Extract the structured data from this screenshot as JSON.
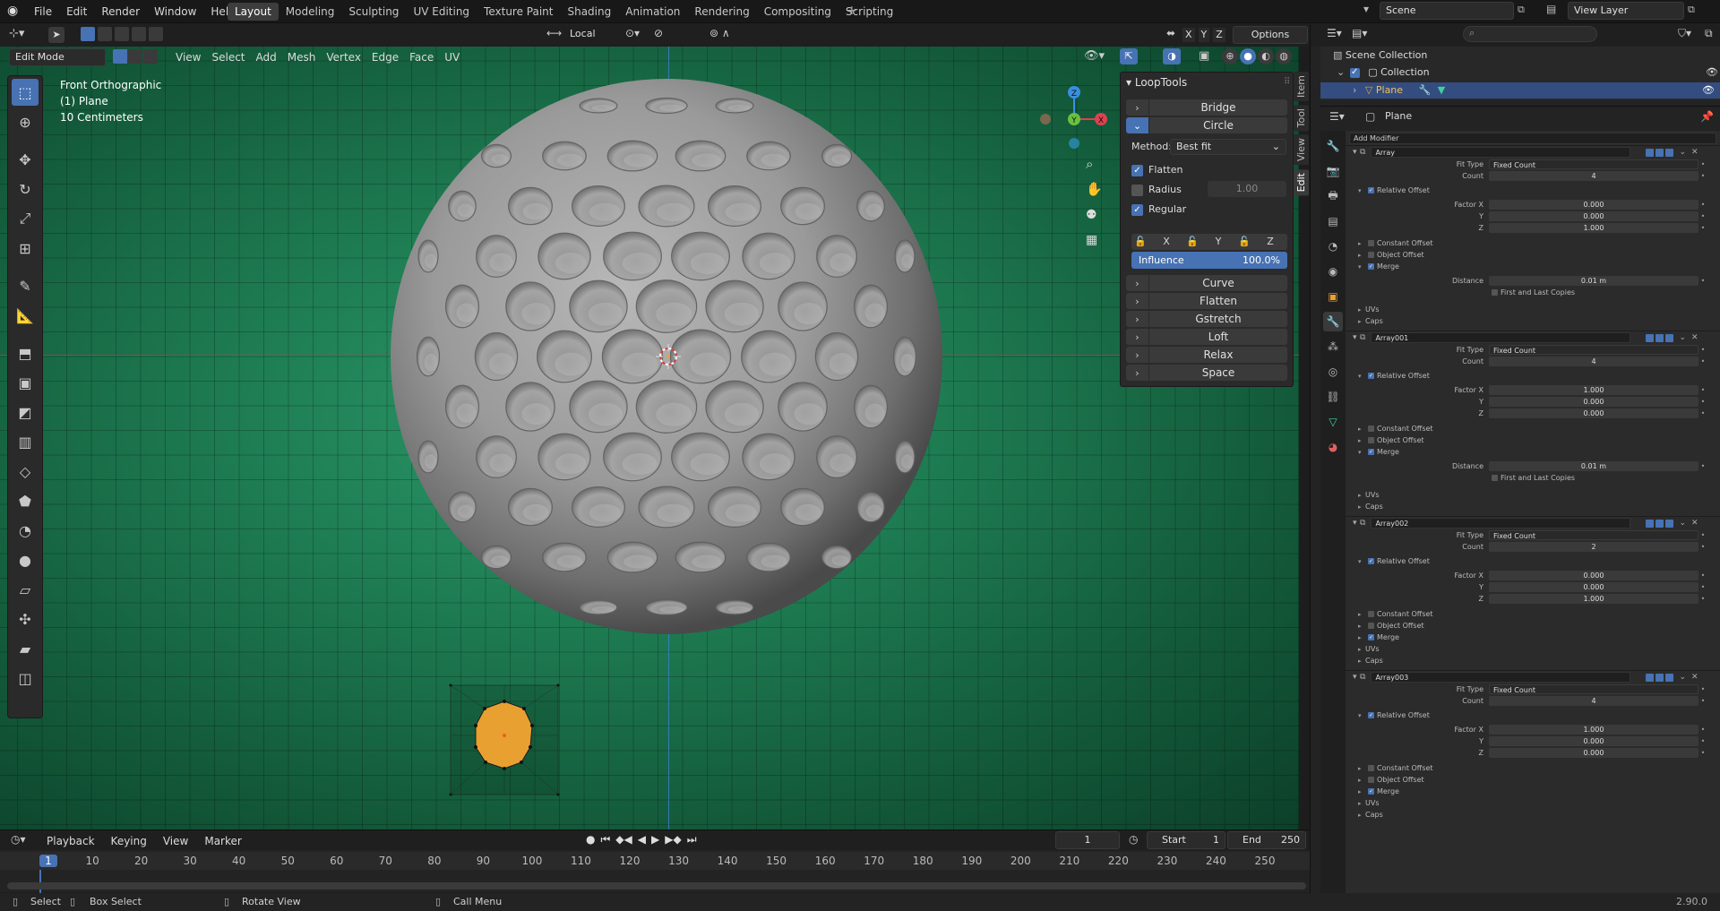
{
  "app": {
    "menu": [
      "File",
      "Edit",
      "Render",
      "Window",
      "Help"
    ],
    "workspaces": [
      "Layout",
      "Modeling",
      "Sculpting",
      "UV Editing",
      "Texture Paint",
      "Shading",
      "Animation",
      "Rendering",
      "Compositing",
      "Scripting"
    ],
    "active_workspace": "Layout",
    "scene": "Scene",
    "view_layer": "View Layer"
  },
  "viewport": {
    "mode": "Edit Mode",
    "menus": [
      "View",
      "Select",
      "Add",
      "Mesh",
      "Vertex",
      "Edge",
      "Face",
      "UV"
    ],
    "orientation": "Local",
    "options_label": "Options",
    "axis_x": "X",
    "axis_y": "Y",
    "axis_z": "Z",
    "overlay_title": "Front Orthographic",
    "overlay_object": "(1) Plane",
    "overlay_scale": "10 Centimeters",
    "gizmo_x": "X",
    "gizmo_y": "Y",
    "gizmo_z": "Z"
  },
  "looptools": {
    "title": "LoopTools",
    "bridge": "Bridge",
    "circle": "Circle",
    "method_label": "Method:",
    "method_value": "Best fit",
    "flatten_label": "Flatten",
    "radius_label": "Radius",
    "radius_value": "1.00",
    "regular_label": "Regular",
    "lock_x": "X",
    "lock_y": "Y",
    "lock_z": "Z",
    "influence_label": "Influence",
    "influence_value": "100.0%",
    "curve": "Curve",
    "flatten2": "Flatten",
    "gstretch": "Gstretch",
    "loft": "Loft",
    "relax": "Relax",
    "space": "Space"
  },
  "side_tabs": [
    "Item",
    "Tool",
    "View",
    "Edit"
  ],
  "timeline": {
    "menus": [
      "Playback",
      "Keying",
      "View",
      "Marker"
    ],
    "current_frame": "1",
    "start_label": "Start",
    "start_value": "1",
    "end_label": "End",
    "end_value": "250",
    "ticks": [
      "1",
      "10",
      "20",
      "30",
      "40",
      "50",
      "60",
      "70",
      "80",
      "90",
      "100",
      "110",
      "120",
      "130",
      "140",
      "150",
      "160",
      "170",
      "180",
      "190",
      "200",
      "210",
      "220",
      "230",
      "240",
      "250"
    ]
  },
  "statusbar": {
    "select": "Select",
    "box_select": "Box Select",
    "rotate_view": "Rotate View",
    "call_menu": "Call Menu",
    "version": "2.90.0"
  },
  "outliner": {
    "root": "Scene Collection",
    "collection": "Collection",
    "object": "Plane"
  },
  "properties": {
    "object_name": "Plane",
    "add_modifier": "Add Modifier",
    "modifiers": [
      {
        "name": "Array",
        "fit_type": "Fixed Count",
        "count": "4",
        "factor_x": "0.000",
        "factor_y": "0.000",
        "factor_z": "1.000",
        "distance": "0.01 m",
        "has_merge_details": true
      },
      {
        "name": "Array001",
        "fit_type": "Fixed Count",
        "count": "4",
        "factor_x": "1.000",
        "factor_y": "0.000",
        "factor_z": "0.000",
        "distance": "0.01 m",
        "has_merge_details": true
      },
      {
        "name": "Array002",
        "fit_type": "Fixed Count",
        "count": "2",
        "factor_x": "0.000",
        "factor_y": "0.000",
        "factor_z": "1.000",
        "has_merge_details": false
      },
      {
        "name": "Array003",
        "fit_type": "Fixed Count",
        "count": "4",
        "factor_x": "1.000",
        "factor_y": "0.000",
        "factor_z": "0.000",
        "has_merge_details": false
      }
    ],
    "labels": {
      "fit_type": "Fit Type",
      "count": "Count",
      "relative_offset": "Relative Offset",
      "factor_x": "Factor X",
      "y": "Y",
      "z": "Z",
      "constant_offset": "Constant Offset",
      "object_offset": "Object Offset",
      "merge": "Merge",
      "distance": "Distance",
      "first_last": "First and Last Copies",
      "uvs": "UVs",
      "caps": "Caps"
    }
  },
  "colors": {
    "accent": "#4772b3",
    "selection_orange": "#f0a030",
    "axis_red": "#e04050",
    "axis_green": "#6ac040",
    "axis_blue": "#3a8fe0"
  }
}
